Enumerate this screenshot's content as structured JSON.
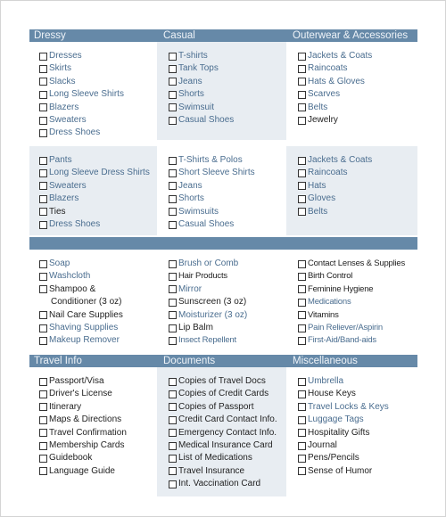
{
  "sections": [
    {
      "headers": [
        "Dressy",
        "Casual",
        "Outerwear & Accessories"
      ],
      "columns": [
        {
          "items": [
            {
              "label": "Dresses",
              "tone": "blue"
            },
            {
              "label": "Skirts",
              "tone": "blue"
            },
            {
              "label": "Slacks",
              "tone": "blue"
            },
            {
              "label": "Long Sleeve Shirts",
              "tone": "blue"
            },
            {
              "label": "Blazers",
              "tone": "blue"
            },
            {
              "label": "Sweaters",
              "tone": "blue"
            },
            {
              "label": "Dress Shoes",
              "tone": "blue"
            }
          ]
        },
        {
          "items": [
            {
              "label": "T-shirts",
              "tone": "blue"
            },
            {
              "label": "Tank Tops",
              "tone": "blue"
            },
            {
              "label": "Jeans",
              "tone": "blue"
            },
            {
              "label": "Shorts",
              "tone": "blue"
            },
            {
              "label": "Swimsuit",
              "tone": "blue"
            },
            {
              "label": "Casual Shoes",
              "tone": "blue"
            }
          ]
        },
        {
          "items": [
            {
              "label": "Jackets & Coats",
              "tone": "blue"
            },
            {
              "label": "Raincoats",
              "tone": "blue"
            },
            {
              "label": "Hats & Gloves",
              "tone": "blue"
            },
            {
              "label": "Scarves",
              "tone": "blue"
            },
            {
              "label": "Belts",
              "tone": "blue"
            },
            {
              "label": "Jewelry",
              "tone": "dark"
            }
          ]
        }
      ]
    },
    {
      "headers": [],
      "columns": [
        {
          "items": [
            {
              "label": "Pants",
              "tone": "blue"
            },
            {
              "label": "Long Sleeve Dress Shirts",
              "tone": "blue"
            },
            {
              "label": "Sweaters",
              "tone": "blue"
            },
            {
              "label": "Blazers",
              "tone": "blue"
            },
            {
              "label": "Ties",
              "tone": "dark"
            },
            {
              "label": "Dress Shoes",
              "tone": "blue"
            }
          ]
        },
        {
          "items": [
            {
              "label": "T-Shirts & Polos",
              "tone": "blue"
            },
            {
              "label": "Short Sleeve Shirts",
              "tone": "blue"
            },
            {
              "label": "Jeans",
              "tone": "blue"
            },
            {
              "label": "Shorts",
              "tone": "blue"
            },
            {
              "label": "Swimsuits",
              "tone": "blue"
            },
            {
              "label": "Casual Shoes",
              "tone": "blue"
            }
          ]
        },
        {
          "items": [
            {
              "label": "Jackets & Coats",
              "tone": "blue"
            },
            {
              "label": "Raincoats",
              "tone": "blue"
            },
            {
              "label": "Hats",
              "tone": "blue"
            },
            {
              "label": "Gloves",
              "tone": "blue"
            },
            {
              "label": "Belts",
              "tone": "blue"
            }
          ]
        }
      ]
    },
    {
      "headers": [],
      "columns": [
        {
          "items": [
            {
              "label": "Soap",
              "tone": "blue"
            },
            {
              "label": "Washcloth",
              "tone": "blue"
            },
            {
              "label": "Shampoo &",
              "tone": "dark"
            },
            {
              "label": "Conditioner (3 oz)",
              "tone": "dark",
              "continuation": true
            },
            {
              "label": "Nail Care Supplies",
              "tone": "dark"
            },
            {
              "label": "Shaving Supplies",
              "tone": "blue"
            },
            {
              "label": "Makeup Remover",
              "tone": "blue"
            }
          ]
        },
        {
          "items": [
            {
              "label": "Brush or Comb",
              "tone": "blue"
            },
            {
              "label": "Hair Products",
              "tone": "dark"
            },
            {
              "label": "Mirror",
              "tone": "blue"
            },
            {
              "label": "Sunscreen (3 oz)",
              "tone": "dark"
            },
            {
              "label": "Moisturizer (3 oz)",
              "tone": "blue"
            },
            {
              "label": "Lip Balm",
              "tone": "dark"
            },
            {
              "label": "Insect Repellent",
              "tone": "blue"
            }
          ]
        },
        {
          "items": [
            {
              "label": "Contact Lenses & Supplies",
              "tone": "dark"
            },
            {
              "label": "Birth Control",
              "tone": "dark"
            },
            {
              "label": "Feminine Hygiene",
              "tone": "dark"
            },
            {
              "label": "Medications",
              "tone": "blue"
            },
            {
              "label": "Vitamins",
              "tone": "dark"
            },
            {
              "label": "Pain Reliever/Aspirin",
              "tone": "blue"
            },
            {
              "label": "First-Aid/Band-aids",
              "tone": "blue"
            }
          ]
        }
      ]
    },
    {
      "headers": [
        "Travel Info",
        "Documents",
        "Miscellaneous"
      ],
      "columns": [
        {
          "items": [
            {
              "label": "Passport/Visa",
              "tone": "dark"
            },
            {
              "label": "Driver's License",
              "tone": "dark"
            },
            {
              "label": "Itinerary",
              "tone": "dark"
            },
            {
              "label": "Maps & Directions",
              "tone": "dark"
            },
            {
              "label": "Travel Confirmation",
              "tone": "dark"
            },
            {
              "label": "Membership Cards",
              "tone": "dark"
            },
            {
              "label": "Guidebook",
              "tone": "dark"
            },
            {
              "label": "Language Guide",
              "tone": "dark"
            }
          ]
        },
        {
          "items": [
            {
              "label": "Copies of Travel Docs",
              "tone": "dark"
            },
            {
              "label": "Copies of Credit Cards",
              "tone": "dark"
            },
            {
              "label": "Copies of Passport",
              "tone": "dark"
            },
            {
              "label": "Credit Card Contact Info.",
              "tone": "dark"
            },
            {
              "label": "Emergency Contact Info.",
              "tone": "dark"
            },
            {
              "label": "Medical Insurance Card",
              "tone": "dark"
            },
            {
              "label": "List of Medications",
              "tone": "dark"
            },
            {
              "label": "Travel Insurance",
              "tone": "dark"
            },
            {
              "label": "Int. Vaccination Card",
              "tone": "dark"
            }
          ]
        },
        {
          "items": [
            {
              "label": "Umbrella",
              "tone": "blue"
            },
            {
              "label": "House Keys",
              "tone": "dark"
            },
            {
              "label": "Travel Locks & Keys",
              "tone": "blue"
            },
            {
              "label": "Luggage Tags",
              "tone": "blue"
            },
            {
              "label": "Hospitality Gifts",
              "tone": "dark"
            },
            {
              "label": "Journal",
              "tone": "dark"
            },
            {
              "label": "Pens/Pencils",
              "tone": "dark"
            },
            {
              "label": "Sense of Humor",
              "tone": "dark"
            }
          ]
        }
      ]
    }
  ],
  "colors": {
    "header_bg": "#6689a8",
    "header_text": "#eef3f8",
    "shade": "#e8edf2",
    "blue_text": "#4a6d8f",
    "dark_text": "#222222"
  }
}
